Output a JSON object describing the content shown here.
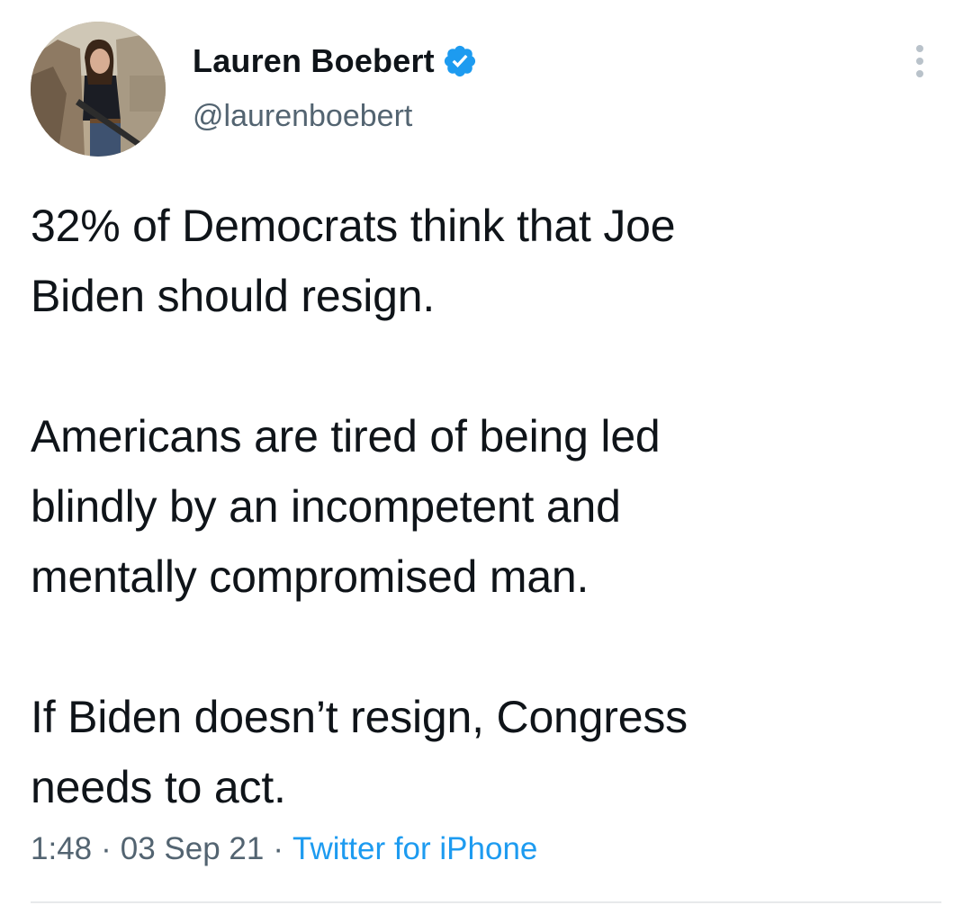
{
  "author": {
    "display_name": "Lauren Boebert",
    "handle": "@laurenboebert",
    "verified": true,
    "verified_icon": "verified-badge-icon",
    "verified_color": "#1d9bf0"
  },
  "tweet": {
    "paragraphs": [
      "32% of Democrats think that Joe\nBiden should resign.",
      "Americans are tired of being led\nblindly by an incompetent and\nmentally compromised man.",
      "If Biden doesn’t resign, Congress\nneeds to act."
    ],
    "time": "1:48",
    "date": "03 Sep 21",
    "separator": "·",
    "source": "Twitter for iPhone"
  },
  "icons": {
    "more": "more-options-icon"
  },
  "colors": {
    "text": "#0f1419",
    "secondary": "#536471",
    "link": "#1d9bf0",
    "divider": "#e7e9eb"
  }
}
